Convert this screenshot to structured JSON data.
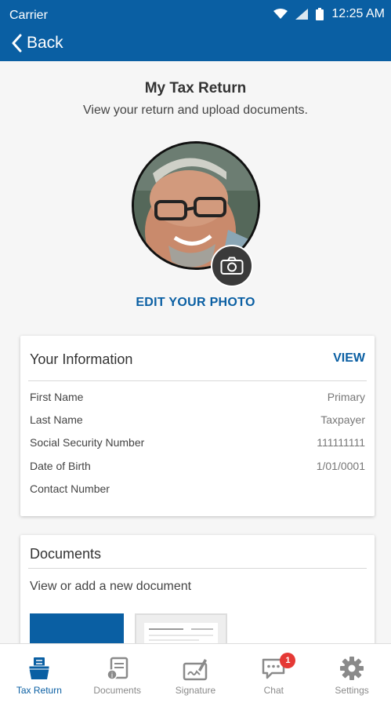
{
  "status_bar": {
    "carrier": "Carrier",
    "time": "12:25 AM"
  },
  "nav": {
    "back_label": "Back"
  },
  "header": {
    "title": "My Tax Return",
    "subtitle": "View your return and upload documents."
  },
  "photo": {
    "edit_label": "EDIT YOUR PHOTO"
  },
  "your_info": {
    "title": "Your Information",
    "view_label": "VIEW",
    "rows": [
      {
        "label": "First Name",
        "value": "Primary"
      },
      {
        "label": "Last Name",
        "value": "Taxpayer"
      },
      {
        "label": "Social Security Number",
        "value": "111111111"
      },
      {
        "label": "Date of Birth",
        "value": "1/01/0001"
      },
      {
        "label": "Contact Number",
        "value": ""
      }
    ]
  },
  "documents": {
    "title": "Documents",
    "subtitle": "View or add a new document"
  },
  "tabbar": {
    "tabs": [
      {
        "label": "Tax Return",
        "icon": "tax-return-icon",
        "active": true
      },
      {
        "label": "Documents",
        "icon": "documents-icon",
        "active": false
      },
      {
        "label": "Signature",
        "icon": "signature-icon",
        "active": false
      },
      {
        "label": "Chat",
        "icon": "chat-icon",
        "active": false,
        "badge": "1"
      },
      {
        "label": "Settings",
        "icon": "gear-icon",
        "active": false
      }
    ]
  },
  "colors": {
    "brand": "#0a5fa3",
    "badge": "#e53935"
  }
}
